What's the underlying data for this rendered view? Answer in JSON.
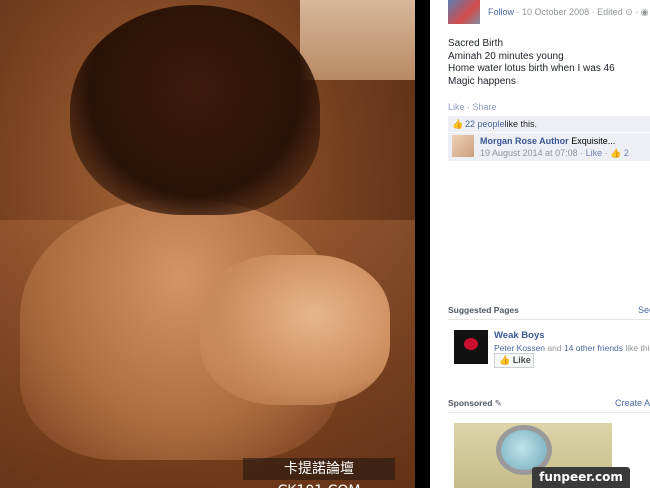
{
  "photo": {
    "watermark": "卡提諾論壇 CK101.COM"
  },
  "post": {
    "follow_label": "Follow",
    "date": "10 October 2008",
    "edited_label": "Edited",
    "text_lines": [
      "Sacred Birth",
      "Aminah 20 minutes young",
      "Home water lotus birth when I was 46",
      "Magic happens"
    ],
    "like_label": "Like",
    "share_label": "Share",
    "likes_count_link": "22 people",
    "likes_suffix": " like this."
  },
  "comment": {
    "author": "Morgan Rose Author",
    "text": "Exquisite...",
    "date": "19 August 2014 at 07:08",
    "like_label": "Like",
    "like_count": "2"
  },
  "suggested_pages": {
    "title": "Suggested Pages",
    "see_label": "See",
    "page_name": "Weak Boys",
    "friend_name": "Peter Kossen",
    "and_label": " and ",
    "other_friends": "14 other friends",
    "suffix": " like this",
    "like_button": "Like"
  },
  "sponsored": {
    "title": "Sponsored",
    "create_ad": "Create Ad"
  },
  "site_badge": "funpeer.com",
  "colors": {
    "link": "#4b67a1",
    "highlight_bg": "#edeff4",
    "meta_text": "#90949c"
  }
}
